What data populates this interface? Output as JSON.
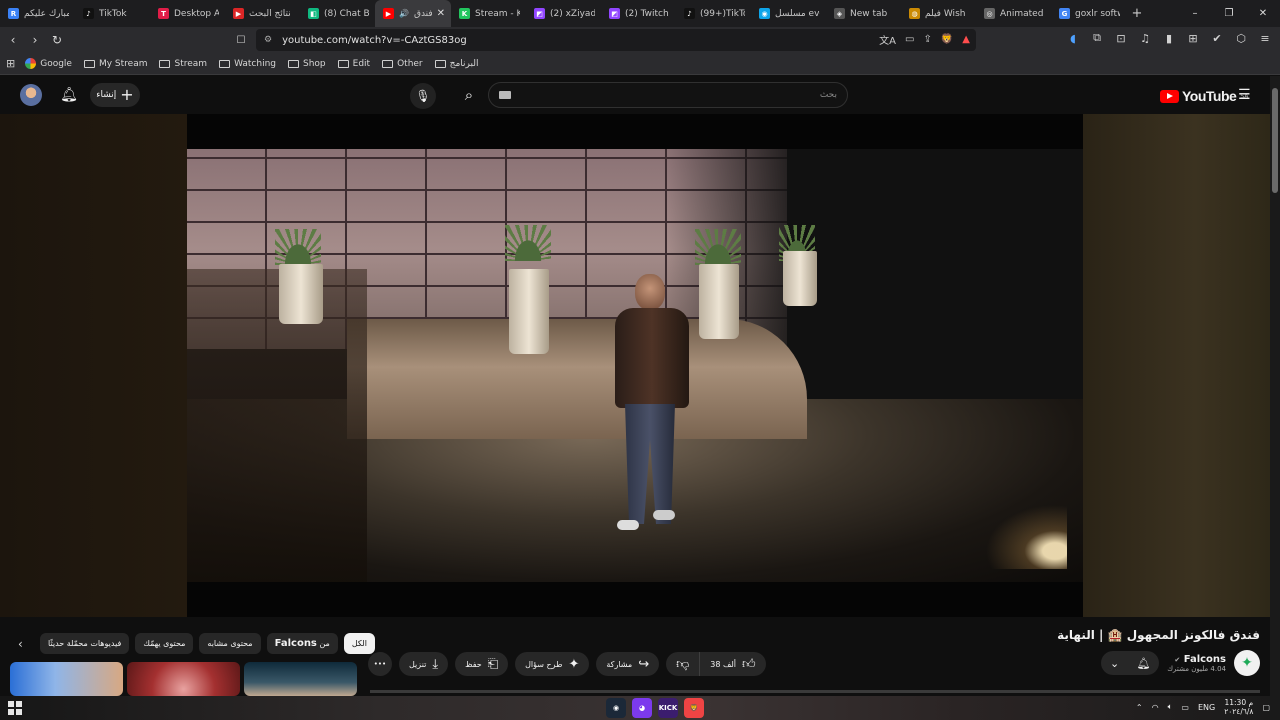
{
  "tabs": [
    {
      "label": "مبارك عليكم",
      "favicon": "R",
      "color": "#3b82f6"
    },
    {
      "label": "TikTok",
      "favicon": "♪",
      "color": "#111111"
    },
    {
      "label": "Desktop Ap",
      "favicon": "T",
      "color": "#e11d48"
    },
    {
      "label": "نتائج البحث",
      "favicon": "▶",
      "color": "#dc2626"
    },
    {
      "label": "(8) Chat Bo",
      "favicon": "◧",
      "color": "#10b981"
    },
    {
      "label": "فندق",
      "favicon": "▶",
      "color": "#ff0000",
      "active": true,
      "audio": "🔊",
      "close": "✕"
    },
    {
      "label": "Stream - Ki",
      "favicon": "K",
      "color": "#22c55e"
    },
    {
      "label": "(2) xZiyad -",
      "favicon": "◩",
      "color": "#9146ff"
    },
    {
      "label": "(2) Twitch",
      "favicon": "◩",
      "color": "#9146ff"
    },
    {
      "label": "(99+)TikTok",
      "favicon": "♪",
      "color": "#111111"
    },
    {
      "label": "مسلسل evel",
      "favicon": "◉",
      "color": "#0ea5e9"
    },
    {
      "label": "New tab",
      "favicon": "◈",
      "color": "#555555"
    },
    {
      "label": "فيلم Wish",
      "favicon": "◍",
      "color": "#ca8a04"
    },
    {
      "label": "Animated G",
      "favicon": "◎",
      "color": "#666666"
    },
    {
      "label": "goxlr softw",
      "favicon": "G",
      "color": "#4285f4"
    }
  ],
  "tab_new": "+",
  "window_controls": {
    "minimize": "–",
    "restore": "❐",
    "close": "✕"
  },
  "address_bar": {
    "back": "‹",
    "forward": "›",
    "reload": "↻",
    "bookmark": "☐",
    "url": "youtube.com/watch?v=-CAztGS83og",
    "icons": [
      "文A",
      "▭",
      "⇪",
      "🦁",
      "▲"
    ]
  },
  "extensions": [
    "◖",
    "⧉",
    "⊡",
    "♫",
    "▮",
    "⊞",
    "✔",
    "⬡",
    "≡"
  ],
  "bookmarks": [
    {
      "label": "Google",
      "type": "google"
    },
    {
      "label": "My Stream",
      "type": "folder"
    },
    {
      "label": "Stream",
      "type": "folder"
    },
    {
      "label": "Watching",
      "type": "folder"
    },
    {
      "label": "Shop",
      "type": "folder"
    },
    {
      "label": "Edit",
      "type": "folder"
    },
    {
      "label": "Other",
      "type": "folder"
    },
    {
      "label": "البرنامج",
      "type": "folder"
    }
  ],
  "youtube": {
    "create_label": "إنشاء",
    "search_placeholder": "بحث",
    "logo_text": "YouTube",
    "region": "SA"
  },
  "video": {
    "title": "فندق فالكونز المجهول 🏨 | النهاية"
  },
  "channel": {
    "name": "Falcons",
    "subscribers": "4.04 مليون مشترك",
    "avatar_glyph": "✦"
  },
  "actions": {
    "likes": "38 ألف",
    "share": "مشاركة",
    "ask": "طرح سؤال",
    "save": "حفظ",
    "download": "تنزيل",
    "more": "•••"
  },
  "chips": [
    {
      "label": "الكل",
      "active": true
    },
    {
      "label": "من",
      "bold": "Falcons"
    },
    {
      "label": "محتوى مشابه"
    },
    {
      "label": "محتوى يهمّك"
    },
    {
      "label": "فيديوهات محمّلة حديثًا"
    }
  ],
  "taskbar": {
    "apps": [
      {
        "glyph": "◉",
        "color": "#1b2838"
      },
      {
        "glyph": "◕",
        "color": "#7c3aed"
      },
      {
        "glyph": "KICK",
        "color": "#3b1d6e"
      },
      {
        "glyph": "🦁",
        "color": "#ef4444"
      }
    ],
    "language": "ENG",
    "time": "11:30 م",
    "date": "٢٠٢٤/٦/٨"
  }
}
